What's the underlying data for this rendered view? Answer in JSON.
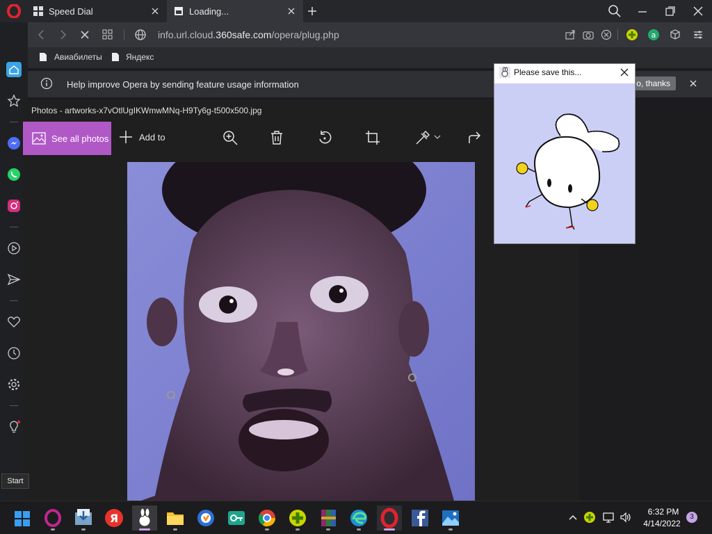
{
  "browser": {
    "tabs": [
      {
        "label": "Speed Dial"
      },
      {
        "label": "Loading..."
      }
    ],
    "address": {
      "prefix": "info.url.cloud.",
      "domain": "360safe.com",
      "suffix": "/opera/plug.php"
    },
    "bookmarks": [
      {
        "label": "Авиабилеты"
      },
      {
        "label": "Яндекс"
      }
    ],
    "infobar": {
      "message": "Help improve Opera by sending feature usage information",
      "button": "o, thanks"
    }
  },
  "photos": {
    "title": "Photos - artworks-x7vOtlUgIKWmwMNq-H9Ty6g-t500x500.jpg",
    "see_all": "See all photos",
    "add_to": "Add to"
  },
  "popup": {
    "title": "Please save this..."
  },
  "tooltip": {
    "start": "Start"
  },
  "taskbar": {
    "time": "6:32 PM",
    "date": "4/14/2022",
    "notifications": "3"
  },
  "colors": {
    "accent": "#b158c7",
    "opera_red": "#e0232e",
    "popup_bg": "#cccff5"
  }
}
